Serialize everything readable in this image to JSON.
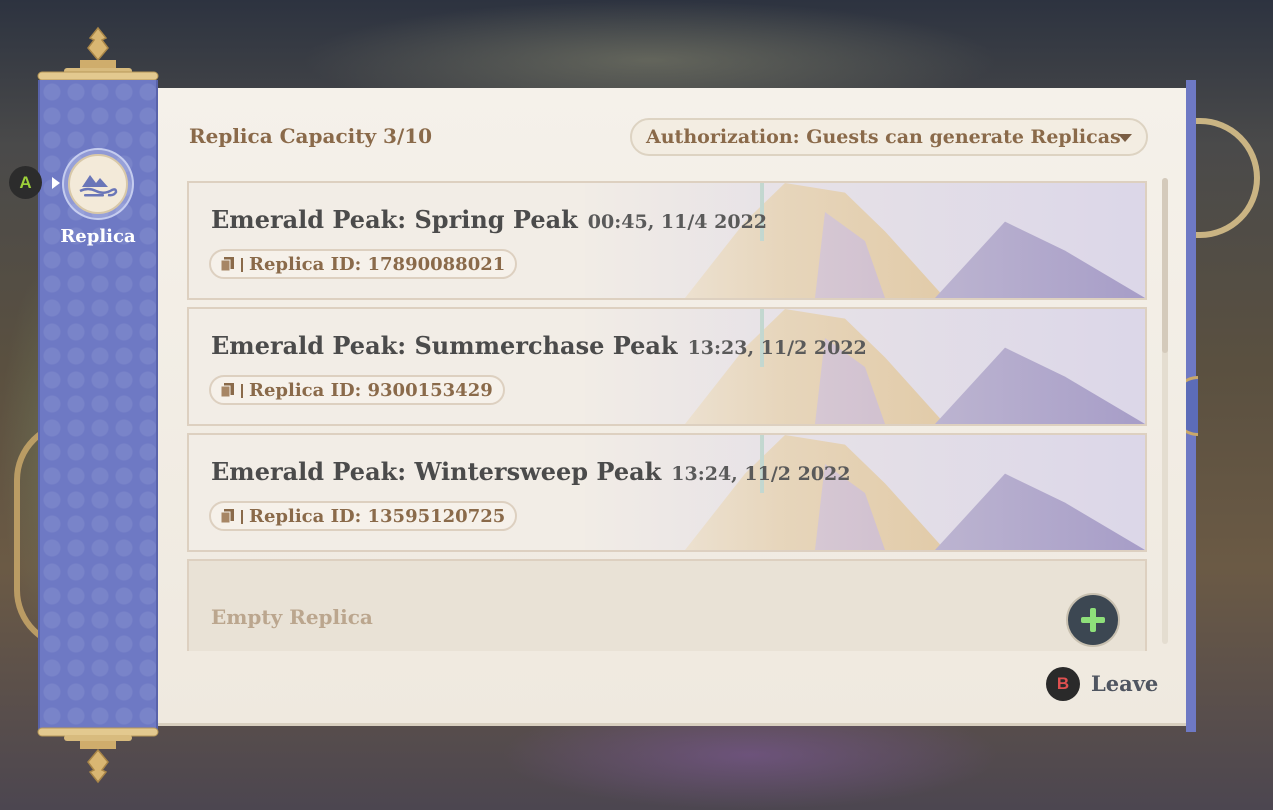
{
  "sidebar": {
    "hint_key": "A",
    "tab_label": "Replica",
    "tab_icon": "mountain-cloud-icon"
  },
  "header": {
    "capacity": "Replica Capacity 3/10",
    "authorization": "Authorization: Guests can generate Replicas"
  },
  "replicas": [
    {
      "title": "Emerald Peak: Spring Peak",
      "time": "00:45, 11/4 2022",
      "id_text": "Replica ID: 17890088021"
    },
    {
      "title": "Emerald Peak: Summerchase Peak",
      "time": "13:23, 11/2 2022",
      "id_text": "Replica ID: 9300153429"
    },
    {
      "title": "Emerald Peak: Wintersweep Peak",
      "time": "13:24, 11/2 2022",
      "id_text": "Replica ID: 13595120725"
    }
  ],
  "empty_slot": {
    "label": "Empty Replica"
  },
  "footer": {
    "hint_key": "B",
    "leave_label": "Leave"
  },
  "colors": {
    "sidebar_blue": "#6e79c4",
    "accent_brown": "#8a6a4a",
    "gold": "#c9a86a",
    "add_green": "#8ee07a"
  }
}
